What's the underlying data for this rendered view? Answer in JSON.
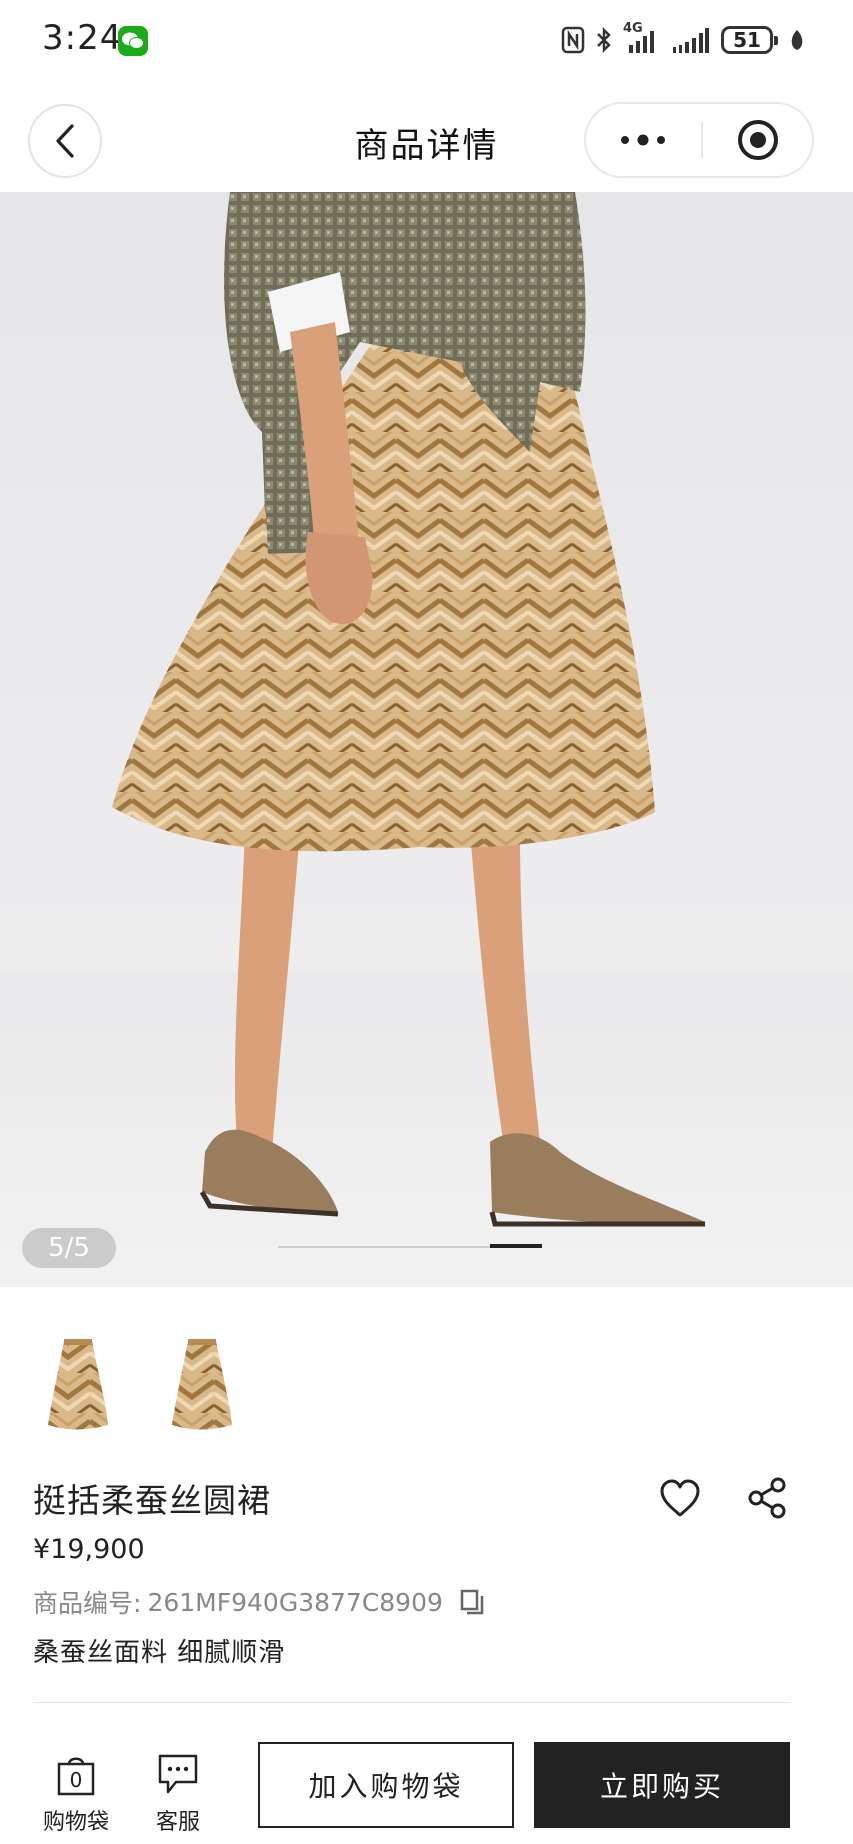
{
  "status_bar": {
    "time": "3:24",
    "network": "4G",
    "battery": "51"
  },
  "nav": {
    "title": "商品详情"
  },
  "gallery": {
    "counter": "5/5",
    "current_index": 5,
    "total": 5
  },
  "product": {
    "name": "挺括柔蚕丝圆裙",
    "price": "¥19,900",
    "sku_label": "商品编号:",
    "sku_value": "261MF940G3877C8909",
    "tagline": "桑蚕丝面料 细腻顺滑"
  },
  "bottom_bar": {
    "bag_label": "购物袋",
    "bag_count": "0",
    "service_label": "客服",
    "add_to_bag": "加入购物袋",
    "buy_now": "立即购买"
  },
  "colors": {
    "accent_dark": "#222222",
    "wechat_green": "#1aad19"
  }
}
